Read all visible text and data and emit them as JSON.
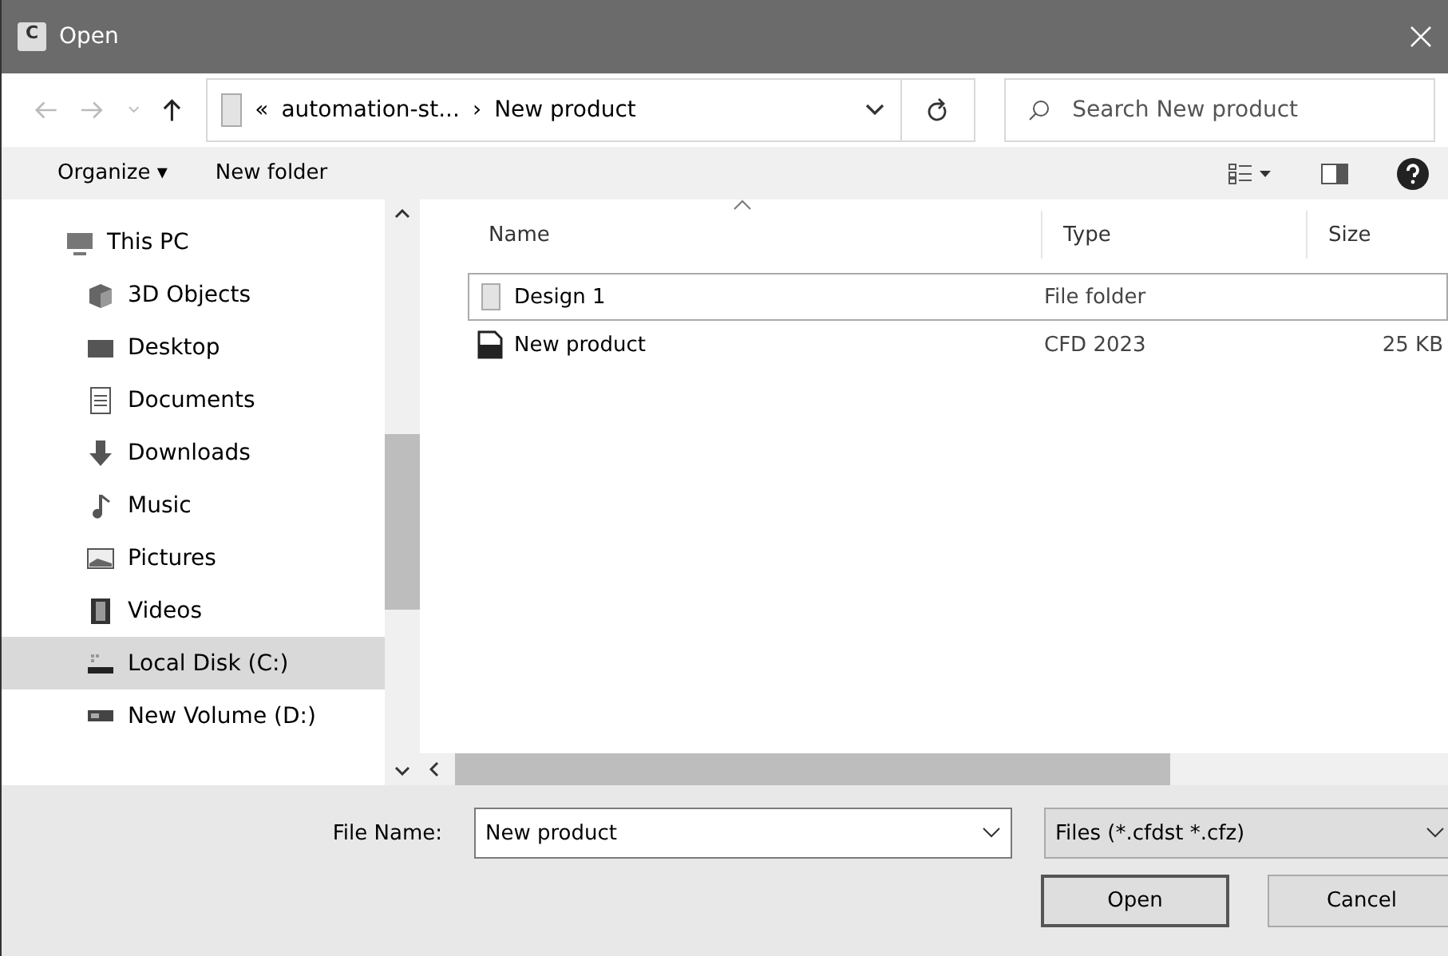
{
  "window": {
    "title": "Open",
    "app_icon": "C"
  },
  "address": {
    "overflow": "«",
    "path": [
      "automation-st...",
      "New product"
    ],
    "separator": "›",
    "search_placeholder": "Search New product"
  },
  "toolbar": {
    "organize": "Organize",
    "organize_caret": "▾",
    "new_folder": "New folder"
  },
  "nav": [
    {
      "label": "This PC",
      "selected": false
    },
    {
      "label": "3D Objects",
      "selected": false
    },
    {
      "label": "Desktop",
      "selected": false
    },
    {
      "label": "Documents",
      "selected": false
    },
    {
      "label": "Downloads",
      "selected": false
    },
    {
      "label": "Music",
      "selected": false
    },
    {
      "label": "Pictures",
      "selected": false
    },
    {
      "label": "Videos",
      "selected": false
    },
    {
      "label": "Local Disk (C:)",
      "selected": true
    },
    {
      "label": "New Volume (D:)",
      "selected": false
    }
  ],
  "table": {
    "columns": [
      "Name",
      "Type",
      "Size"
    ],
    "rows": [
      {
        "name": "Design 1",
        "type": "File folder",
        "size": "",
        "kind": "folder",
        "selected": true
      },
      {
        "name": "New product",
        "type": "CFD 2023",
        "size": "25 KB",
        "kind": "file",
        "selected": false
      }
    ]
  },
  "footer": {
    "file_name_label": "File Name:",
    "file_name": "New product",
    "file_type": "Files (*.cfdst *.cfz)",
    "buttons": [
      "Open",
      "Cancel"
    ]
  }
}
